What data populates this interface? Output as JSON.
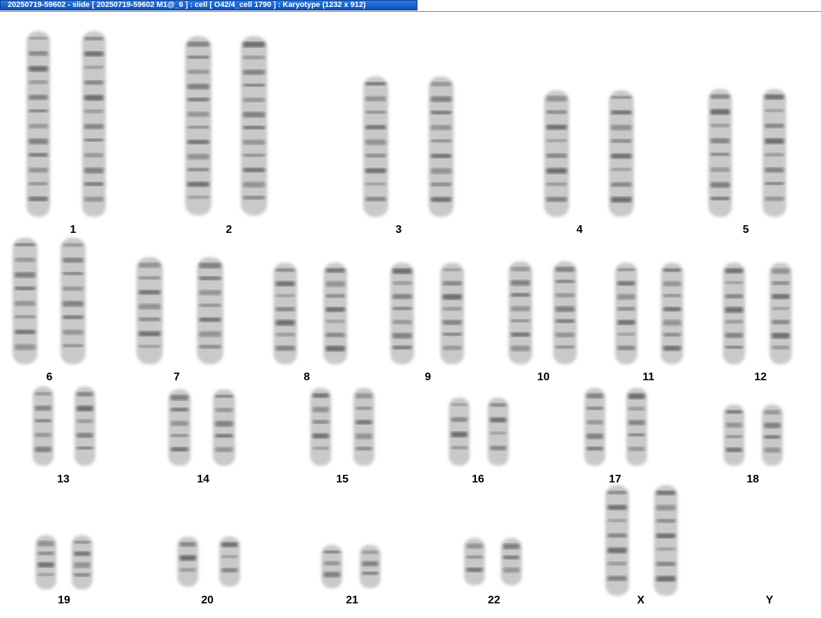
{
  "window": {
    "title": "20250719-59602 - slide [ 20250719-59602 M1@_6 ] : cell [ O42/4_cell 1790 ] : Karyotype  (1232 x 912)"
  },
  "karyotype": {
    "labels": [
      "1",
      "2",
      "3",
      "4",
      "5",
      "6",
      "7",
      "8",
      "9",
      "10",
      "11",
      "12",
      "13",
      "14",
      "15",
      "16",
      "17",
      "18",
      "19",
      "20",
      "21",
      "22",
      "X",
      "Y"
    ]
  },
  "colors": {
    "title_bar": "#1560d8",
    "band_dark": "#4a4a4a",
    "chromatid": "#c9c9c9"
  }
}
